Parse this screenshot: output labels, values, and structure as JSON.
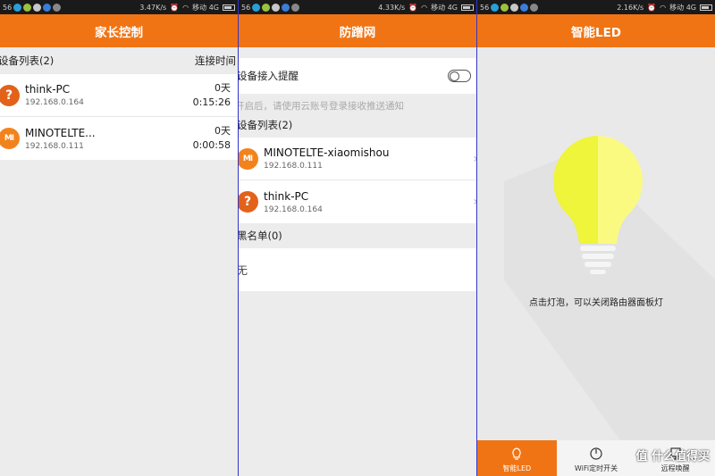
{
  "colors": {
    "accent": "#f07414",
    "statusbar": "#1a1a1a",
    "background": "#ececec",
    "bulb": "#f4f53a"
  },
  "panels": [
    {
      "status": {
        "left": "56",
        "speed": "3.47K/s",
        "carrier": "移动 4G"
      },
      "title": "家长控制",
      "section": {
        "label": "设备列表(2)",
        "right": "连接时间"
      },
      "devices": [
        {
          "icon": "question-icon",
          "glyph": "?",
          "name": "think-PC",
          "ip": "192.168.0.164",
          "days": "0天",
          "time": "0:15:26"
        },
        {
          "icon": "mi-logo-icon",
          "glyph": "MI",
          "name": "MINOTELTE...",
          "ip": "192.168.0.111",
          "days": "0天",
          "time": "0:00:58"
        }
      ]
    },
    {
      "status": {
        "left": "56",
        "speed": "4.33K/s",
        "carrier": "移动 4G"
      },
      "title": "防蹭网",
      "toggle_label": "设备接入提醒",
      "hint": "开启后，请使用云账号登录接收推送通知",
      "section": {
        "label": "设备列表(2)"
      },
      "devices": [
        {
          "icon": "mi-logo-icon",
          "glyph": "MI",
          "name": "MINOTELTE-xiaomishou",
          "ip": "192.168.0.111"
        },
        {
          "icon": "question-icon",
          "glyph": "?",
          "name": "think-PC",
          "ip": "192.168.0.164"
        }
      ],
      "blacklist": {
        "label": "黑名单(0)",
        "empty": "无"
      }
    },
    {
      "status": {
        "left": "56",
        "speed": "2.16K/s",
        "carrier": "移动 4G"
      },
      "title": "智能LED",
      "caption": "点击灯泡，可以关闭路由器面板灯",
      "tabs": [
        {
          "label": "智能LED",
          "icon": "lightbulb-icon",
          "active": true
        },
        {
          "label": "WiFi定时开关",
          "icon": "power-icon",
          "active": false
        },
        {
          "label": "远程唤醒",
          "icon": "monitor-icon",
          "active": false
        }
      ],
      "watermark": "值 什么值得买"
    }
  ]
}
